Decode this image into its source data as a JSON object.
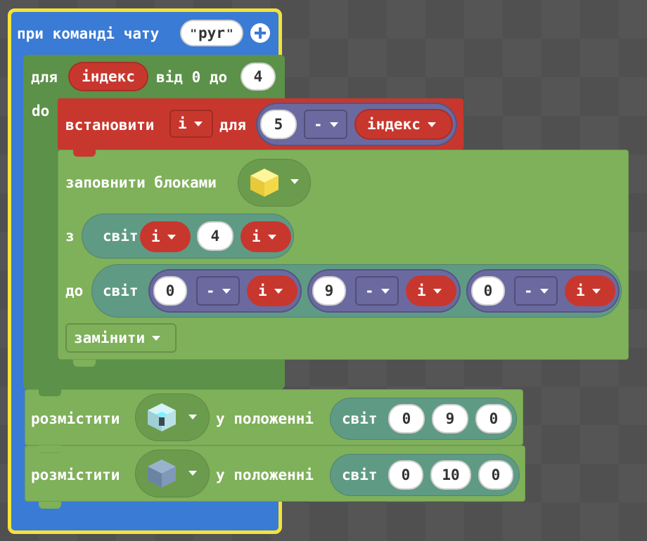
{
  "event": {
    "label": "при команді чату",
    "command": "pyr",
    "add_icon": "plus-circle-icon"
  },
  "loop": {
    "label_for": "для",
    "variable": "індекс",
    "label_from": "від",
    "from_value": "0",
    "label_to": "до",
    "to_value": "4",
    "label_do": "do"
  },
  "set_block": {
    "label": "встановити",
    "variable": "i",
    "label_for": "для",
    "left": "5",
    "operator": "-",
    "right_variable": "індекс"
  },
  "fill_block": {
    "label": "заповнити блоками",
    "block_icon": "yellow-cube-icon",
    "label_from": "з",
    "label_to": "до",
    "mode": "замінити"
  },
  "from_pos": {
    "label": "світ",
    "x": "i",
    "y": "4",
    "z": "i"
  },
  "to_pos": {
    "label": "світ",
    "x": {
      "left": "0",
      "op": "-",
      "right": "i"
    },
    "y": {
      "left": "9",
      "op": "-",
      "right": "i"
    },
    "z": {
      "left": "0",
      "op": "-",
      "right": "i"
    }
  },
  "place1": {
    "label": "розмістити",
    "block_icon": "glass-beacon-block-icon",
    "at_label": "у положенні",
    "pos_label": "світ",
    "x": "0",
    "y": "9",
    "z": "0"
  },
  "place2": {
    "label": "розмістити",
    "block_icon": "blue-stone-block-icon",
    "at_label": "у положенні",
    "pos_label": "світ",
    "x": "0",
    "y": "10",
    "z": "0"
  },
  "colors": {
    "event": "#3a7bd5",
    "loop": "#5b9148",
    "var": "#c8372d",
    "math": "#6a6aa0",
    "blocks": "#7fb05a",
    "pos": "#5f9a85",
    "highlight": "#f5e23a"
  }
}
